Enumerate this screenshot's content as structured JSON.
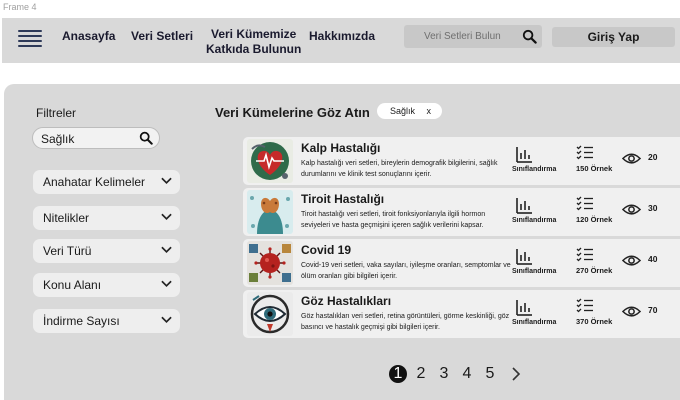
{
  "frame_label": "Frame 4",
  "header": {
    "nav": [
      "Anasayfa",
      "Veri Setleri",
      "Veri Kümemize",
      "Katkıda Bulunun",
      "Hakkımızda"
    ],
    "search_placeholder": "Veri Setleri Bulun",
    "login_label": "Giriş Yap"
  },
  "filters": {
    "title": "Filtreler",
    "search_value": "Sağlık",
    "dropdowns": [
      "Anahatar Kelimeler",
      "Nitelikler",
      "Veri Türü",
      "Konu Alanı",
      "İndirme Sayısı"
    ]
  },
  "list": {
    "title": "Veri Kümelerine Göz Atın",
    "chip_label": "Sağlık",
    "chip_close": "x",
    "items": [
      {
        "title": "Kalp Hastalığı",
        "desc": "Kalp hastalığı veri setleri, bireylerin demografik bilgilerini, sağlık durumlarını ve klinik test sonuçlarını içerir.",
        "type": "Sınıflandırma",
        "count": "150 Örnek",
        "views": "20",
        "icon": "heart-illustration"
      },
      {
        "title": "Tiroit Hastalığı",
        "desc": "Tiroit hastalığı veri setleri, tiroit fonksiyonlarıyla ilgili hormon seviyeleri ve hasta geçmişini içeren sağlık verilerini kapsar.",
        "type": "Sınıflandırma",
        "count": "120 Örnek",
        "views": "30",
        "icon": "thyroid-illustration"
      },
      {
        "title": "Covid 19",
        "desc": "Covid-19 veri setleri, vaka sayıları, iyileşme oranları, semptomlar ve ölüm oranları gibi bilgileri içerir.",
        "type": "Sınıflandırma",
        "count": "270 Örnek",
        "views": "40",
        "icon": "virus-illustration"
      },
      {
        "title": "Göz Hastalıkları",
        "desc": "Göz hastalıkları veri setleri, retina görüntüleri, görme keskinliği, göz basıncı ve hastalık geçmişi gibi bilgileri içerir.",
        "type": "Sınıflandırma",
        "count": "370 Örnek",
        "views": "70",
        "icon": "eye-illustration"
      }
    ]
  },
  "pagination": {
    "pages": [
      "1",
      "2",
      "3",
      "4",
      "5"
    ],
    "active": "1"
  },
  "colors": {
    "header_bg": "#d9d9d9",
    "card_bg": "#f0f0f0",
    "active_page": "#111111"
  }
}
